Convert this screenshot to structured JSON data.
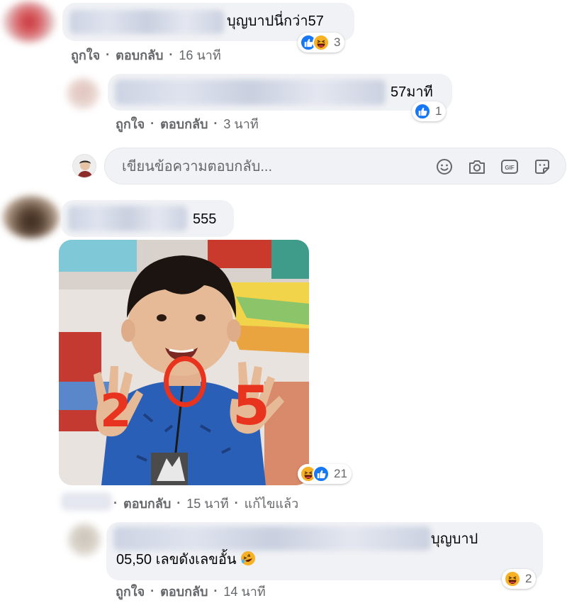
{
  "comments": [
    {
      "text": "บุญบาปนี่กว่า57",
      "actions": {
        "like": "ถูกใจ",
        "reply": "ตอบกลับ",
        "sep": "·",
        "time": "16 นาที"
      },
      "reactions": {
        "count": "3",
        "icons": [
          "like-icon",
          "haha-icon"
        ]
      }
    },
    {
      "text": "57มาที",
      "actions": {
        "like": "ถูกใจ",
        "reply": "ตอบกลับ",
        "sep": "·",
        "time": "3 นาที"
      },
      "reactions": {
        "count": "1",
        "icons": [
          "like-icon"
        ]
      }
    },
    {
      "text": "555",
      "actions": {
        "reply": "ตอบกลับ",
        "sep": "·",
        "time": "15 นาที",
        "edited": "แก้ไขแล้ว"
      },
      "reactions": {
        "count": "21",
        "icons": [
          "haha-icon",
          "like-icon"
        ]
      },
      "photo": {
        "digits": [
          "2",
          "0",
          "5"
        ],
        "digit_color": "#e8331f"
      }
    },
    {
      "text_line1": "บุญบาป",
      "text_line2": "05,50 เลขดังเลขอั้น",
      "emoji": "rolling-laughing-emoji",
      "actions": {
        "like": "ถูกใจ",
        "reply": "ตอบกลับ",
        "sep": "·",
        "time": "14 นาที"
      },
      "reactions": {
        "count": "2",
        "icons": [
          "haha-icon"
        ]
      }
    }
  ],
  "reply_box": {
    "placeholder": "เขียนข้อความตอบกลับ...",
    "tools": [
      "emoji-icon",
      "camera-icon",
      "gif-icon",
      "sticker-icon"
    ],
    "gif_label": "GIF"
  },
  "colors": {
    "bubble": "#f0f2f5",
    "meta_text": "#65676b",
    "like_blue": "#1877f2",
    "haha_yellow": "#f7b125"
  }
}
